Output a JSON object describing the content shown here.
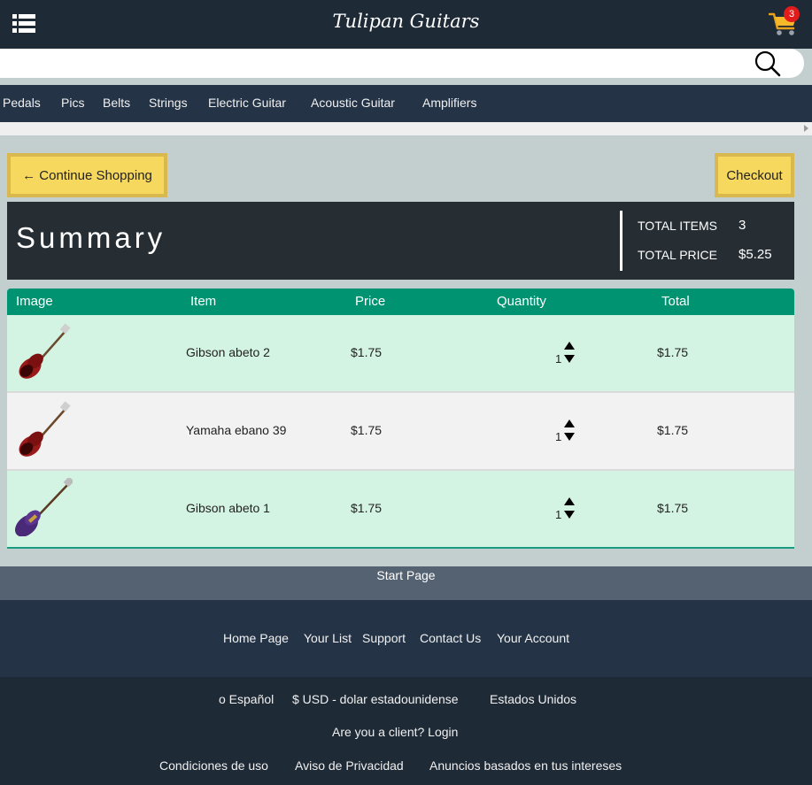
{
  "header": {
    "brand": "Tulipan Guitars",
    "cart_count": "3",
    "menu_icon": "hamburger-list-icon",
    "cart_icon": "shopping-cart-icon",
    "search_icon": "magnifier-icon",
    "search_placeholder": ""
  },
  "categories": [
    "Pedals",
    "Pics",
    "Belts",
    "Strings",
    "Electric Guitar",
    "Acoustic Guitar",
    "Amplifiers"
  ],
  "actions": {
    "continue_label": "← Continue Shopping",
    "checkout_label": "Checkout"
  },
  "summary": {
    "title": "Summary",
    "total_items_label": "TOTAL ITEMS",
    "total_items_value": "3",
    "total_price_label": "TOTAL PRICE",
    "total_price_value": "$5.25"
  },
  "table": {
    "headers": [
      "Image",
      "Item",
      "Price",
      "Quantity",
      "Total"
    ],
    "rows": [
      {
        "name": "Gibson abeto 2",
        "price": "$1.75",
        "qty": "1",
        "total": "$1.75",
        "image": "red-electric-guitar",
        "bg": "#d4f4e3"
      },
      {
        "name": "Yamaha ebano 39",
        "price": "$1.75",
        "qty": "1",
        "total": "$1.75",
        "image": "red-electric-guitar",
        "bg": "#f2f2f2"
      },
      {
        "name": "Gibson abeto 1",
        "price": "$1.75",
        "qty": "1",
        "total": "$1.75",
        "image": "purple-electric-guitar",
        "bg": "#d4f4e3"
      }
    ]
  },
  "start_page": "Start Page",
  "footer": {
    "links": [
      "Home Page",
      "Your List",
      "Support",
      "Contact Us",
      "Your Account"
    ],
    "language": "o Español",
    "currency": "$ USD - dolar estadounidense",
    "country": "Estados Unidos",
    "client_prompt": "Are you a client? Login",
    "legal": [
      "Condiciones de uso",
      "Aviso de Privacidad",
      "Anuncios basados en tus intereses"
    ]
  },
  "colors": {
    "topbar": "#1f2a37",
    "nav": "#243446",
    "accent_button": "#f7d85e",
    "table_header": "#009371",
    "row_alt": "#d4f4e3",
    "badge": "#e21b1b"
  }
}
